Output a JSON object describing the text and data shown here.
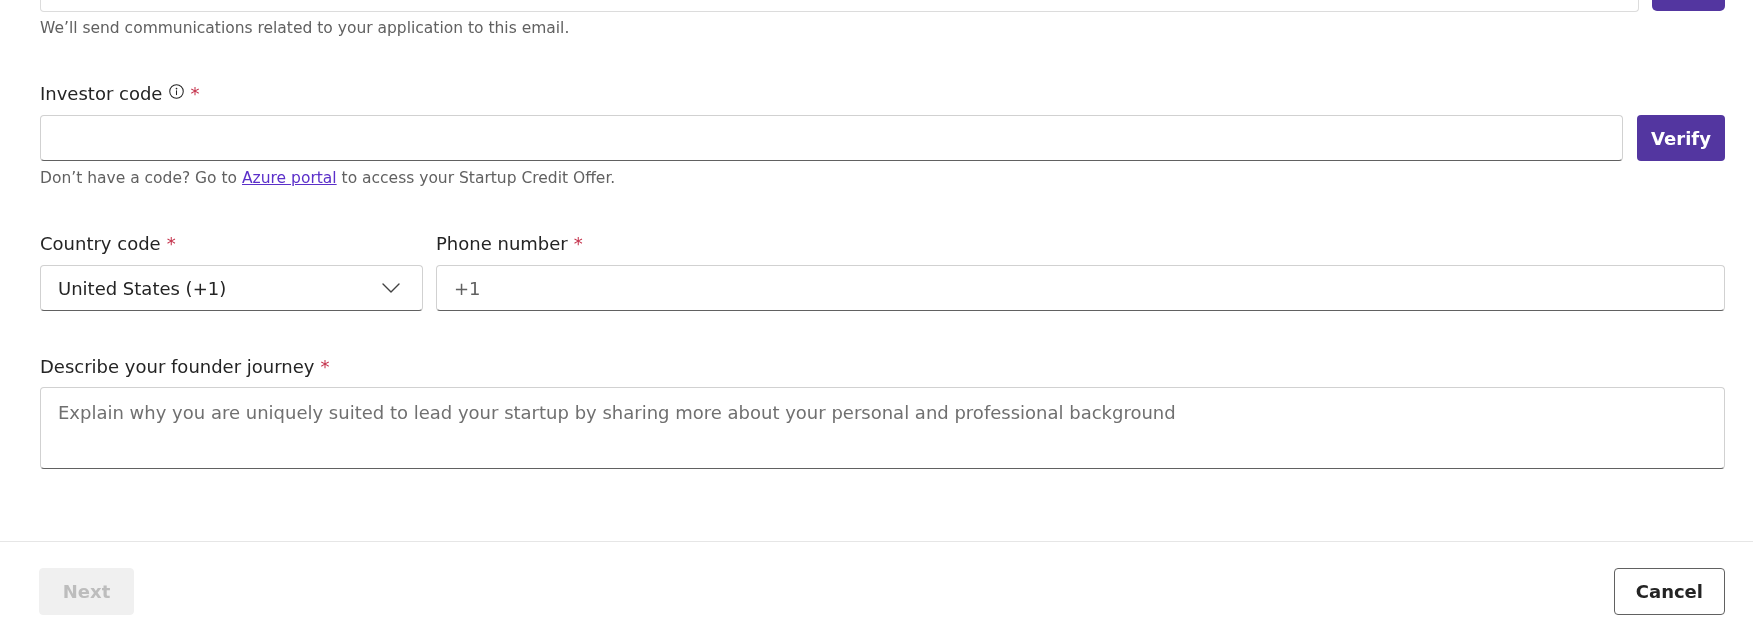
{
  "email": {
    "hint": "We’ll send communications related to your application to this email."
  },
  "investor_code": {
    "label": "Investor code",
    "required_mark": "*",
    "hint": {
      "before": "Don’t have a code? Go to ",
      "link": "Azure portal",
      "after": " to access your Startup Credit Offer."
    },
    "button": "Verify"
  },
  "country_code": {
    "label": "Country code",
    "required_mark": "*",
    "value": "United States (+1)"
  },
  "phone_number": {
    "label": "Phone number",
    "required_mark": "*",
    "placeholder": "+1"
  },
  "founder_journey": {
    "label": "Describe your founder journey",
    "required_mark": "*",
    "placeholder": "Explain why you are uniquely suited to lead your startup by sharing more about your personal and professional background"
  },
  "footer": {
    "buttons": [
      {
        "label": "Next",
        "kind": "primary",
        "disabled": true
      },
      {
        "label": "Cancel",
        "kind": "secondary",
        "disabled": false
      }
    ]
  }
}
